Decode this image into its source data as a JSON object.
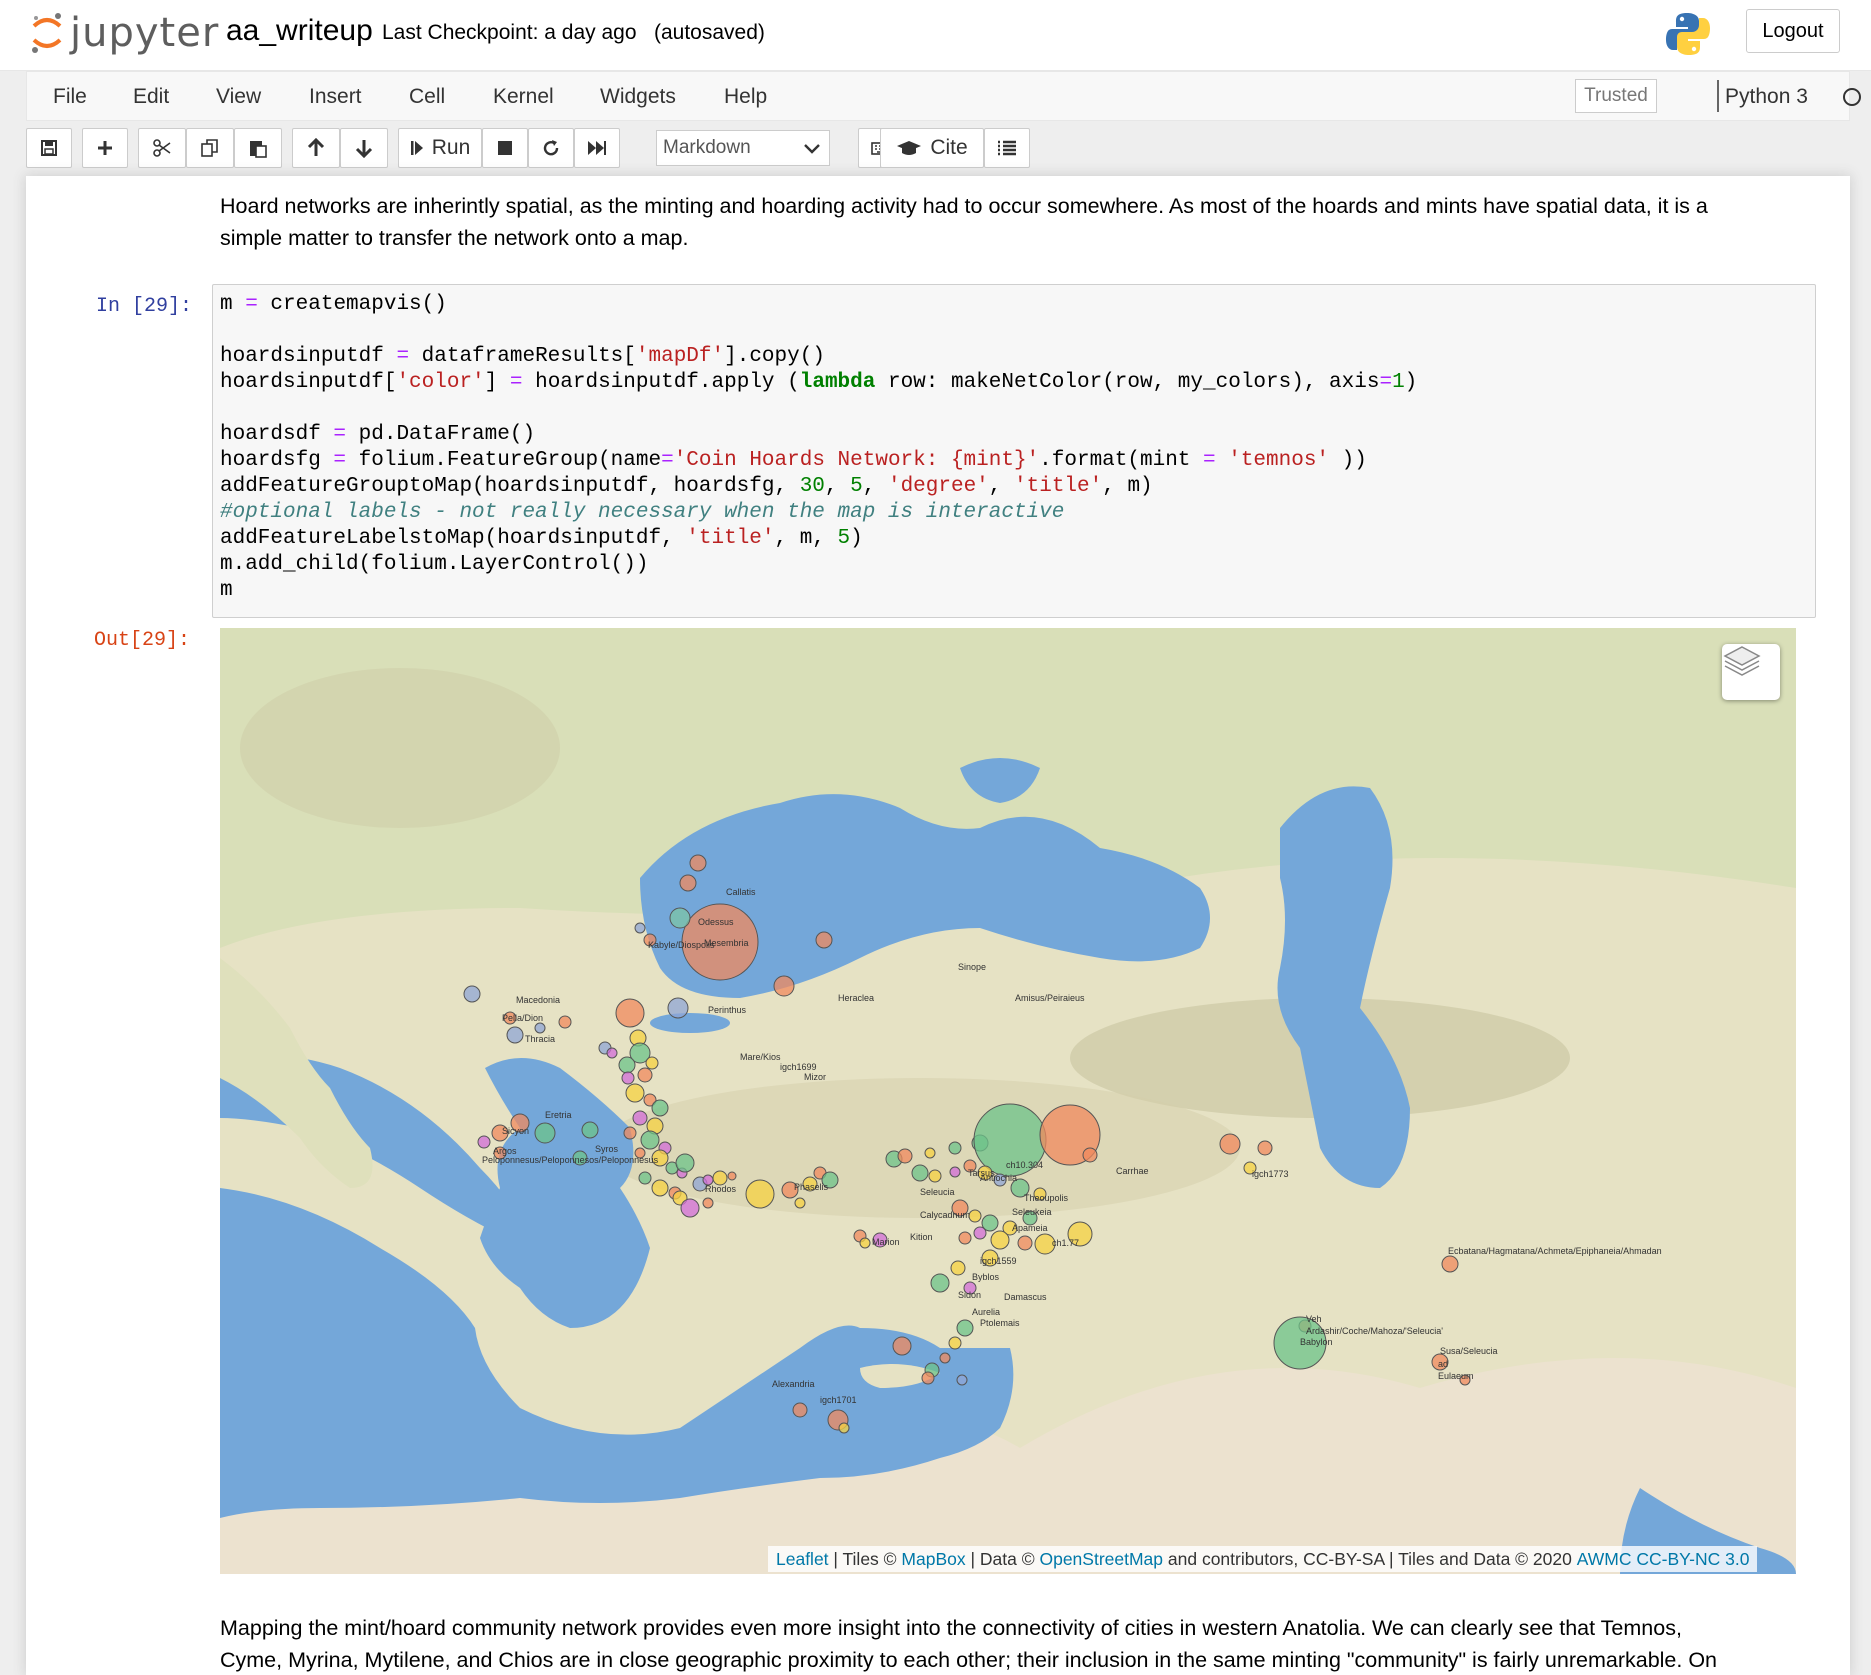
{
  "header": {
    "logo_text": "jupyter",
    "notebook_name": "aa_writeup",
    "checkpoint": "Last Checkpoint: a day ago",
    "autosaved": "(autosaved)",
    "logout_label": "Logout"
  },
  "menubar": {
    "items": [
      "File",
      "Edit",
      "View",
      "Insert",
      "Cell",
      "Kernel",
      "Widgets",
      "Help"
    ],
    "trusted": "Trusted",
    "kernel": "Python 3"
  },
  "toolbar": {
    "run_label": "Run",
    "cell_type": "Markdown",
    "cite_label": "Cite",
    "icons": [
      "save-icon",
      "plus-icon",
      "scissors-icon",
      "copy-icon",
      "paste-icon",
      "arrow-up-icon",
      "arrow-down-icon",
      "step-forward-icon",
      "stop-icon",
      "refresh-icon",
      "fast-forward-icon",
      "keyboard-icon",
      "graduation-cap-icon",
      "list-icon"
    ]
  },
  "cells": {
    "md1": {
      "line1": "Hoard networks are inherintly spatial, as the minting and hoarding activity had to occur somewhere. As most of the hoards and mints have spatial data, it is a",
      "line2": "simple matter to transfer the network onto a map."
    },
    "code": {
      "prompt_in": "In [29]:",
      "prompt_out": "Out[29]:"
    },
    "md2": {
      "line1": "Mapping the mint/hoard community network provides even more insight into the connectivity of cities in western Anatolia. We can clearly see that Temnos,",
      "line2": "Cyme, Myrina, Mytilene, and Chios are in close geographic proximity to each other; their inclusion in the same minting \"community\" is fairly unremarkable. On"
    }
  },
  "map": {
    "attribution": {
      "leaflet": "Leaflet",
      "sep1": " | Tiles © ",
      "mapbox": "MapBox",
      "sep2": " | Data © ",
      "osm": "OpenStreetMap",
      "rest": " and contributors, CC-BY-SA | Tiles and Data © 2020 ",
      "awmc": "AWMC CC-BY-NC 3.0"
    },
    "labels": [
      "Callatis",
      "Odessus",
      "Mesembria",
      "Kabyle/Diospolis",
      "Sinope",
      "Amisus/Peiraieus",
      "Heraclea",
      "Macedonia",
      "Perinthus",
      "Pella/Dion",
      "Thracia",
      "Mare/Kios",
      "Mizor",
      "igch1699",
      "Eretria",
      "Sicyon",
      "Argos",
      "Peloponnesus/Peloponnesos/Peloponnesus",
      "Syros",
      "Phaselis",
      "Rhodos",
      "Seleucia",
      "Calycadnum",
      "Tarsus",
      "Antiochia",
      "Theoupolis",
      "Seleukeia",
      "Apameia",
      "ch1.77",
      "Marion",
      "Kition",
      "igch1559",
      "Byblos",
      "Damascus",
      "Sidon",
      "Aurelia",
      "Ptolemais",
      "Alexandria",
      "igch1701",
      "ch10.304",
      "Carrhae",
      "igch1773",
      "Ecbatana/Hagmatana/Achmeta/Epiphaneia/Ahmadan",
      "Ardashir/Coche/Mahoza/'Seleucia'",
      "Babylon",
      "Susa/Seleucia",
      "ad",
      "Eulaeum",
      "Veh"
    ],
    "layer_icon": "layers-icon"
  }
}
